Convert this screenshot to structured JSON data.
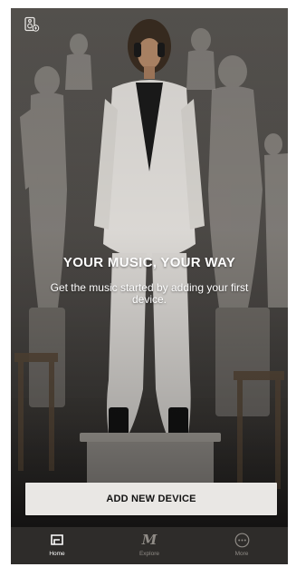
{
  "hero": {
    "headline": "YOUR MUSIC, YOUR WAY",
    "subline": "Get the music started by adding your first device."
  },
  "cta": {
    "label": "ADD NEW DEVICE"
  },
  "tabs": [
    {
      "label": "Home",
      "icon": "speaker-icon",
      "active": true
    },
    {
      "label": "Explore",
      "icon": "marshall-m-icon",
      "active": false
    },
    {
      "label": "More",
      "icon": "more-dots-icon",
      "active": false
    }
  ],
  "top_bar": {
    "icon": "speaker-settings-icon"
  },
  "colors": {
    "tab_active": "#ffffff",
    "tab_inactive": "#8f8b86",
    "cta_background": "#e9e7e4",
    "tabbar_background": "#2e2c2a"
  }
}
